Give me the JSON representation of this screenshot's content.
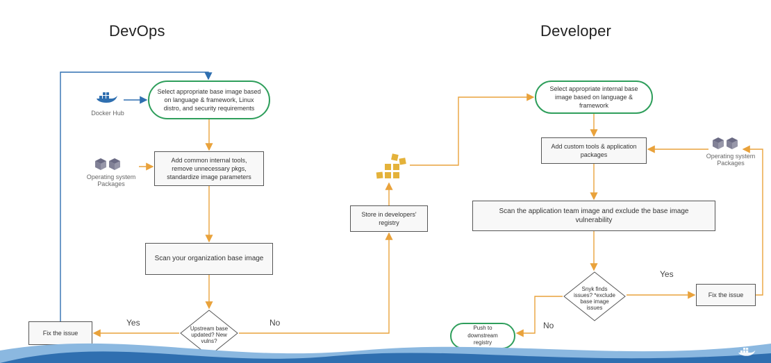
{
  "titles": {
    "left": "DevOps",
    "right": "Developer"
  },
  "devops": {
    "start": "Select appropriate base image based on language & framework, Linux distro, and security requirements",
    "tools": "Add common internal tools, remove unnecessary pkgs, standardize image parameters",
    "scan": "Scan your organization base image",
    "decision": "Upstream base updated? New vulns?",
    "fix": "Fix the issue",
    "store": "Store in developers' registry",
    "yes": "Yes",
    "no": "No",
    "dockerHub": "Docker Hub",
    "osPackages": "Operating system Packages"
  },
  "developer": {
    "start": "Select appropriate internal base image based on language & framework",
    "add": "Add custom tools & application packages",
    "scan": "Scan the application team image  and exclude the base image vulnerability",
    "decision": "Snyk finds issues? *exclude base image issues",
    "fix": "Fix the issue",
    "push": "Push to downstream registry",
    "yes": "Yes",
    "no": "No",
    "osPackages": "Operating system Packages"
  },
  "colors": {
    "green": "#2e9e5b",
    "orange": "#e9a23b",
    "blue": "#2f6fb0",
    "waveDark": "#2f6fb0",
    "waveLight": "#8bb8e0",
    "gray": "#6b6b84",
    "gold": "#e4b23a"
  }
}
